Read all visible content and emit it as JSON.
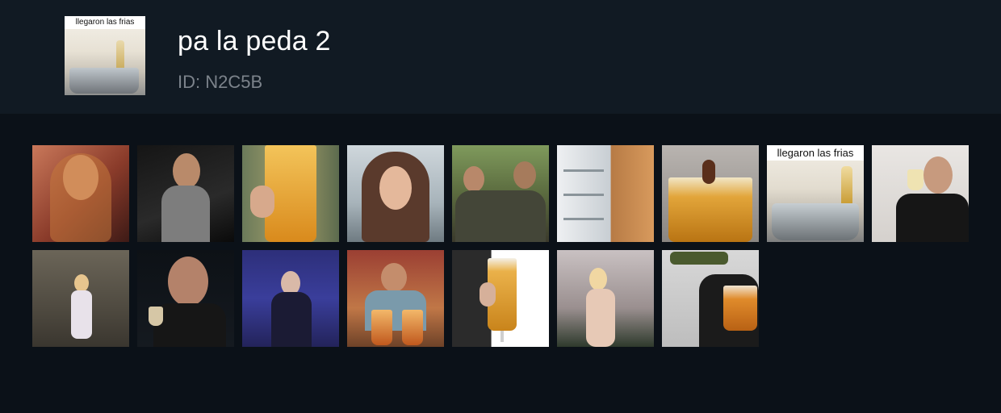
{
  "pack": {
    "name": "pa la peda 2",
    "id_label": "ID: N2C5B",
    "cover_caption": "llegaron las frias"
  },
  "gifs": [
    {
      "kind": "woman-laughing-warm-bar"
    },
    {
      "kind": "woman-dancing-dark"
    },
    {
      "kind": "beer-glass-closeup"
    },
    {
      "kind": "woman-smiling-window"
    },
    {
      "kind": "two-men-toasting-outdoors"
    },
    {
      "kind": "open-fridge"
    },
    {
      "kind": "fly-in-beer-glass"
    },
    {
      "kind": "ice-bucket-beers",
      "caption": "llegaron las frias"
    },
    {
      "kind": "man-raising-wine-glass"
    },
    {
      "kind": "woman-dancing-hallway"
    },
    {
      "kind": "man-raising-shot-glass"
    },
    {
      "kind": "singer-toasting-blue-light"
    },
    {
      "kind": "man-dancing-with-beers"
    },
    {
      "kind": "hand-holding-beer-glass"
    },
    {
      "kind": "woman-dancing-party"
    },
    {
      "kind": "pouring-beer-into-glass"
    }
  ]
}
